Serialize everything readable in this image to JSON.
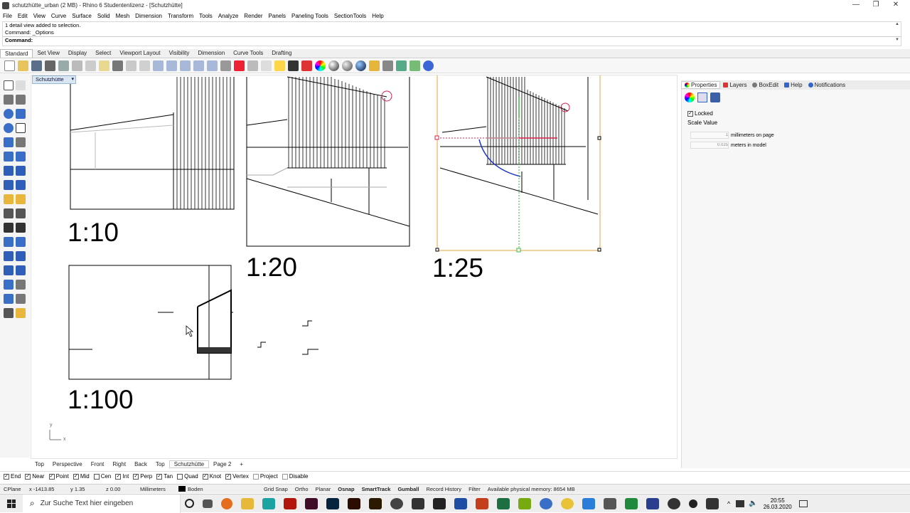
{
  "window": {
    "title": "schutzhütte_urban (2 MB) - Rhino 6 Studentenlizenz - [Schutzhütte]",
    "controls": [
      "—",
      "❐",
      "✕"
    ]
  },
  "menu": [
    "File",
    "Edit",
    "View",
    "Curve",
    "Surface",
    "Solid",
    "Mesh",
    "Dimension",
    "Transform",
    "Tools",
    "Analyze",
    "Render",
    "Panels",
    "Paneling Tools",
    "SectionTools",
    "Help"
  ],
  "command": {
    "history": [
      "1 detail view added to selection.",
      "Command: _Options"
    ],
    "prompt_label": "Command:",
    "value": ""
  },
  "toolbar_tabs": [
    "Standard",
    "Set View",
    "Display",
    "Select",
    "Viewport Layout",
    "Visibility",
    "Dimension",
    "Curve Tools",
    "Drafting"
  ],
  "viewport": {
    "name": "Schutzhütte",
    "scales": [
      "1:10",
      "1:20",
      "1:25",
      "1:100"
    ],
    "axis": {
      "y": "y",
      "x": "x"
    }
  },
  "panel": {
    "tabs": [
      "Properties",
      "Layers",
      "BoxEdit",
      "Help",
      "Notifications"
    ],
    "locked_label": "Locked",
    "scale_value_label": "Scale Value",
    "mm_value": "1",
    "mm_label": "millimeters on page",
    "m_value": "0.025",
    "m_label": "meters in model"
  },
  "view_tabs": [
    "Top",
    "Perspective",
    "Front",
    "Right",
    "Back",
    "Top",
    "Schutzhütte",
    "Page 2",
    "+"
  ],
  "osnap": [
    {
      "label": "End",
      "checked": true
    },
    {
      "label": "Near",
      "checked": true
    },
    {
      "label": "Point",
      "checked": true
    },
    {
      "label": "Mid",
      "checked": true
    },
    {
      "label": "Cen",
      "checked": false
    },
    {
      "label": "Int",
      "checked": true
    },
    {
      "label": "Perp",
      "checked": true
    },
    {
      "label": "Tan",
      "checked": true
    },
    {
      "label": "Quad",
      "checked": false
    },
    {
      "label": "Knot",
      "checked": true
    },
    {
      "label": "Vertex",
      "checked": true
    },
    {
      "label": "Project",
      "checked": false
    },
    {
      "label": "Disable",
      "checked": false
    }
  ],
  "status": {
    "cplane": "CPlane",
    "x": "x -1413.85",
    "y": "y 1.35",
    "z": "z 0.00",
    "units": "Millimeters",
    "layer": "Boden",
    "toggles": [
      "Grid Snap",
      "Ortho",
      "Planar",
      "Osnap",
      "SmartTrack",
      "Gumball",
      "Record History",
      "Filter"
    ],
    "memory": "Available physical memory: 8654 MB"
  },
  "taskbar": {
    "search_placeholder": "Zur Suche Text hier eingeben",
    "time": "20:55",
    "date": "26.03.2020"
  },
  "colors": {
    "selection": "#e8a33c",
    "accent_red": "#d8204a",
    "accent_blue": "#1a2fc8",
    "accent_green": "#3ab83a"
  }
}
